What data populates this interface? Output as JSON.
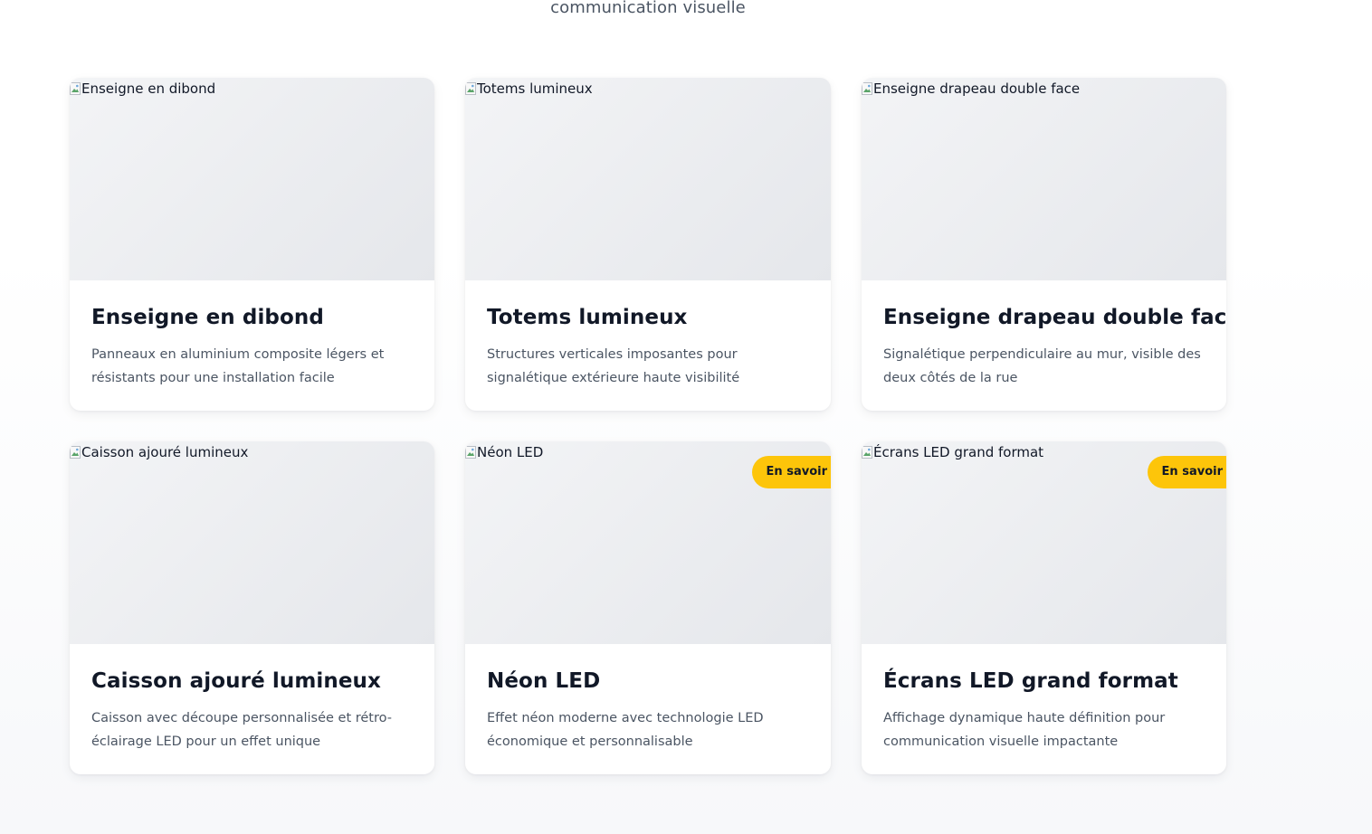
{
  "header": {
    "subtitle": "communication visuelle"
  },
  "cards": [
    {
      "image_alt": "Enseigne en dibond",
      "title": "Enseigne en dibond",
      "description": "Panneaux en aluminium composite légers et résistants pour une installation facile",
      "badge": ""
    },
    {
      "image_alt": "Totems lumineux",
      "title": "Totems lumineux",
      "description": "Structures verticales imposantes pour signalétique extérieure haute visibilité",
      "badge": ""
    },
    {
      "image_alt": "Enseigne drapeau double face",
      "title": "Enseigne drapeau double face",
      "description": "Signalétique perpendiculaire au mur, visible des deux côtés de la rue",
      "badge": ""
    },
    {
      "image_alt": "Caisson ajouré lumineux",
      "title": "Caisson ajouré lumineux",
      "description": "Caisson avec découpe personnalisée et rétro-éclairage LED pour un effet unique",
      "badge": ""
    },
    {
      "image_alt": "Néon LED",
      "title": "Néon LED",
      "description": "Effet néon moderne avec technologie LED économique et personnalisable",
      "badge": "En savoir"
    },
    {
      "image_alt": "Écrans LED grand format",
      "title": "Écrans LED grand format",
      "description": "Affichage dynamique haute définition pour communication visuelle impactante",
      "badge": "En savoir"
    }
  ],
  "colors": {
    "accent": "#fdc50a",
    "title_text": "#111827",
    "body_text": "#4b5563",
    "card_background": "#ffffff",
    "image_placeholder": "#eceef1"
  }
}
